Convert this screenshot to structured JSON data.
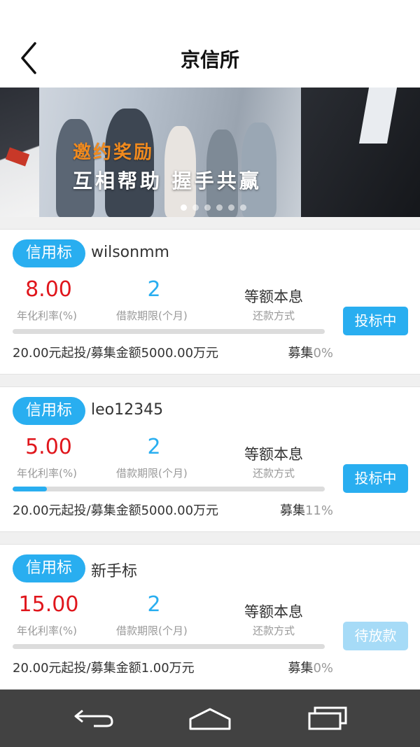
{
  "header": {
    "title": "京信所"
  },
  "banner": {
    "headline": "邀约奖励",
    "subline": "互相帮助 握手共赢",
    "slide_count": 6,
    "active_slide": 0
  },
  "loans": [
    {
      "tag": "信用标",
      "name": "wilsonmm",
      "rate": "8.00",
      "rate_label": "年化利率(%)",
      "term": "2",
      "term_label": "借款期限(个月)",
      "method": "等额本息",
      "method_label": "还款方式",
      "progress": 0,
      "status": "投标中",
      "status_enabled": true,
      "info": "20.00元起投/募集金额5000.00万元",
      "raised_label": "募集",
      "raised_pct": "0%"
    },
    {
      "tag": "信用标",
      "name": "leo12345",
      "rate": "5.00",
      "rate_label": "年化利率(%)",
      "term": "2",
      "term_label": "借款期限(个月)",
      "method": "等额本息",
      "method_label": "还款方式",
      "progress": 11,
      "status": "投标中",
      "status_enabled": true,
      "info": "20.00元起投/募集金额5000.00万元",
      "raised_label": "募集",
      "raised_pct": "11%"
    },
    {
      "tag": "信用标",
      "name": "新手标",
      "rate": "15.00",
      "rate_label": "年化利率(%)",
      "term": "2",
      "term_label": "借款期限(个月)",
      "method": "等额本息",
      "method_label": "还款方式",
      "progress": 0,
      "status": "待放款",
      "status_enabled": false,
      "info": "20.00元起投/募集金额1.00万元",
      "raised_label": "募集",
      "raised_pct": "0%"
    }
  ],
  "colors": {
    "accent": "#29aef0",
    "rate_red": "#e0161c",
    "disabled_button": "#a6dbf7",
    "banner_headline": "#f08a1e"
  },
  "icons": {
    "back": "chevron-left-icon",
    "nav_back": "back-arrow-icon",
    "nav_home": "home-icon",
    "nav_recent": "recent-apps-icon"
  }
}
